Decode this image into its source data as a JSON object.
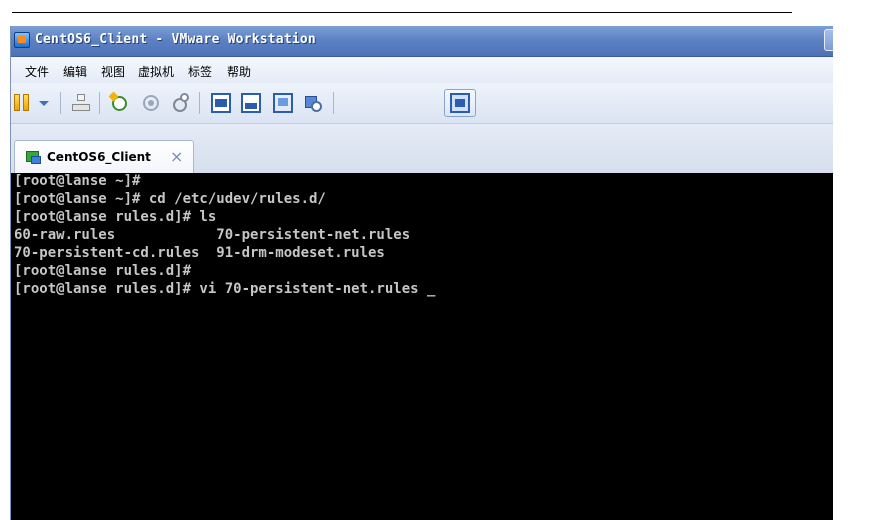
{
  "window": {
    "title": "CentOS6_Client - VMware Workstation"
  },
  "menu": {
    "items": [
      {
        "label": "文件"
      },
      {
        "label": "编辑"
      },
      {
        "label": "视图"
      },
      {
        "label": "虚拟机"
      },
      {
        "label": "标签"
      },
      {
        "label": "帮助"
      }
    ]
  },
  "toolbar": {
    "icons": [
      "pause-icon",
      "dropdown-arrow-icon",
      "network-icon",
      "snapshot-icon",
      "revert-snapshot-icon",
      "manage-snapshots-icon",
      "console-view-icon",
      "quick-switch-icon",
      "fullscreen-icon",
      "unity-icon",
      "library-view-icon"
    ]
  },
  "tab": {
    "label": "CentOS6_Client",
    "close_symbol": "×"
  },
  "console": {
    "lines": [
      "[root@lanse ~]#",
      "[root@lanse ~]# cd /etc/udev/rules.d/",
      "[root@lanse rules.d]# ls",
      "60-raw.rules            70-persistent-net.rules",
      "70-persistent-cd.rules  91-drm-modeset.rules",
      "[root@lanse rules.d]#",
      "[root@lanse rules.d]# vi 70-persistent-net.rules "
    ],
    "cursor": "_"
  },
  "colors": {
    "titlebar": "#5d82c4",
    "console_bg": "#000000",
    "console_fg": "#c6c6c6"
  }
}
